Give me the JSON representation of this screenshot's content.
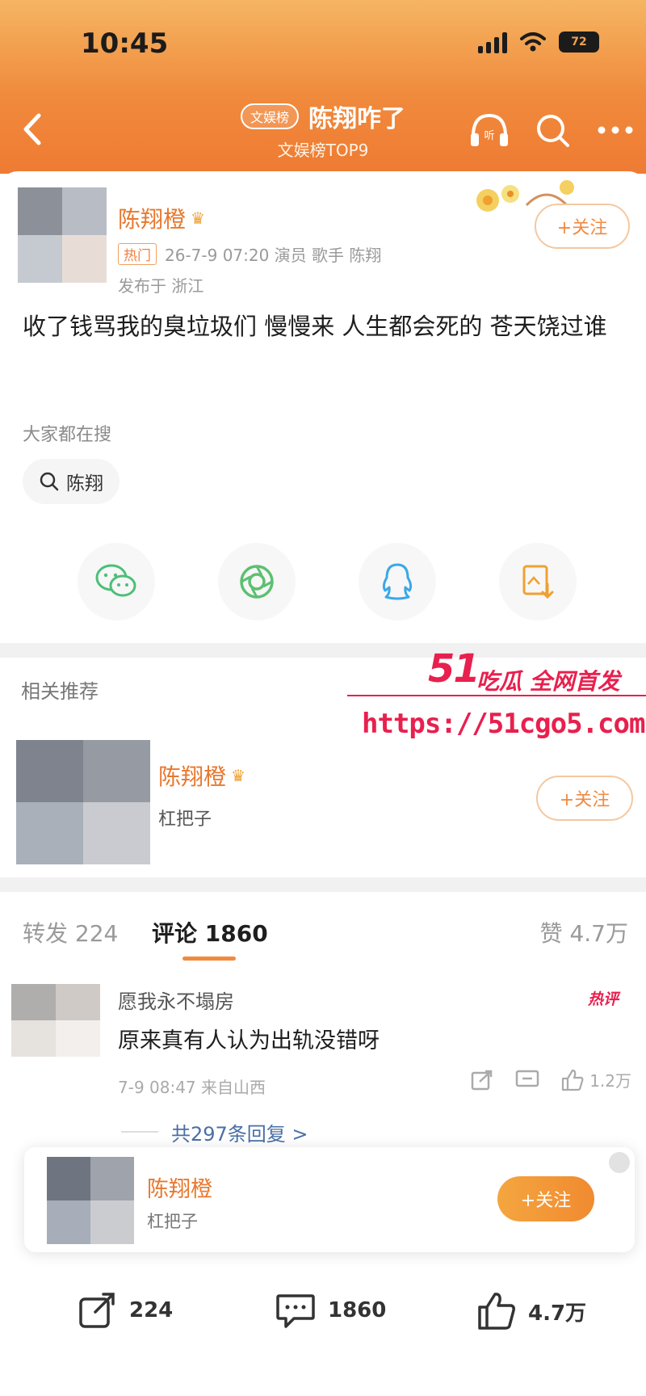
{
  "status_bar": {
    "time": "10:45",
    "battery": "72"
  },
  "nav": {
    "topic_badge": "文娱榜",
    "title": "陈翔咋了",
    "subtitle": "文娱榜TOP9"
  },
  "post": {
    "author": "陈翔橙",
    "hot_tag": "热门",
    "meta": "26-7-9 07:20  演员 歌手 陈翔",
    "location": "发布于 浙江",
    "follow_label": "+关注",
    "text": "收了钱骂我的臭垃圾们 慢慢来 人生都会死的 苍天饶过谁",
    "search_label": "大家都在搜",
    "search_chip": "陈翔"
  },
  "share_icons": [
    "wechat-icon",
    "moments-icon",
    "qq-icon",
    "save-image-icon"
  ],
  "related": {
    "title": "相关推荐",
    "author": "陈翔橙",
    "subtitle": "杠把子",
    "follow_label": "+关注"
  },
  "watermark": {
    "brand_num": "51",
    "brand_text": "吃瓜 全网首发",
    "url": "https://51cgo5.com"
  },
  "tabs": {
    "repost": "转发 224",
    "comments": "评论 1860",
    "likes": "赞 4.7万"
  },
  "comment": {
    "name": "愿我永不塌房",
    "badge": "热评",
    "text": "原来真有人认为出轨没错呀",
    "meta": "7-9 08:47 来自山西",
    "likes": "1.2万",
    "replies": "共297条回复 >"
  },
  "float_bar": {
    "author": "陈翔橙",
    "subtitle": "杠把子",
    "follow_label": "+关注"
  },
  "bottom_bar": {
    "repost": "224",
    "comments": "1860",
    "likes": "4.7万"
  },
  "colors": {
    "accent": "#f08a3c",
    "name_orange": "#e8782e",
    "watermark_red": "#e8204e"
  }
}
